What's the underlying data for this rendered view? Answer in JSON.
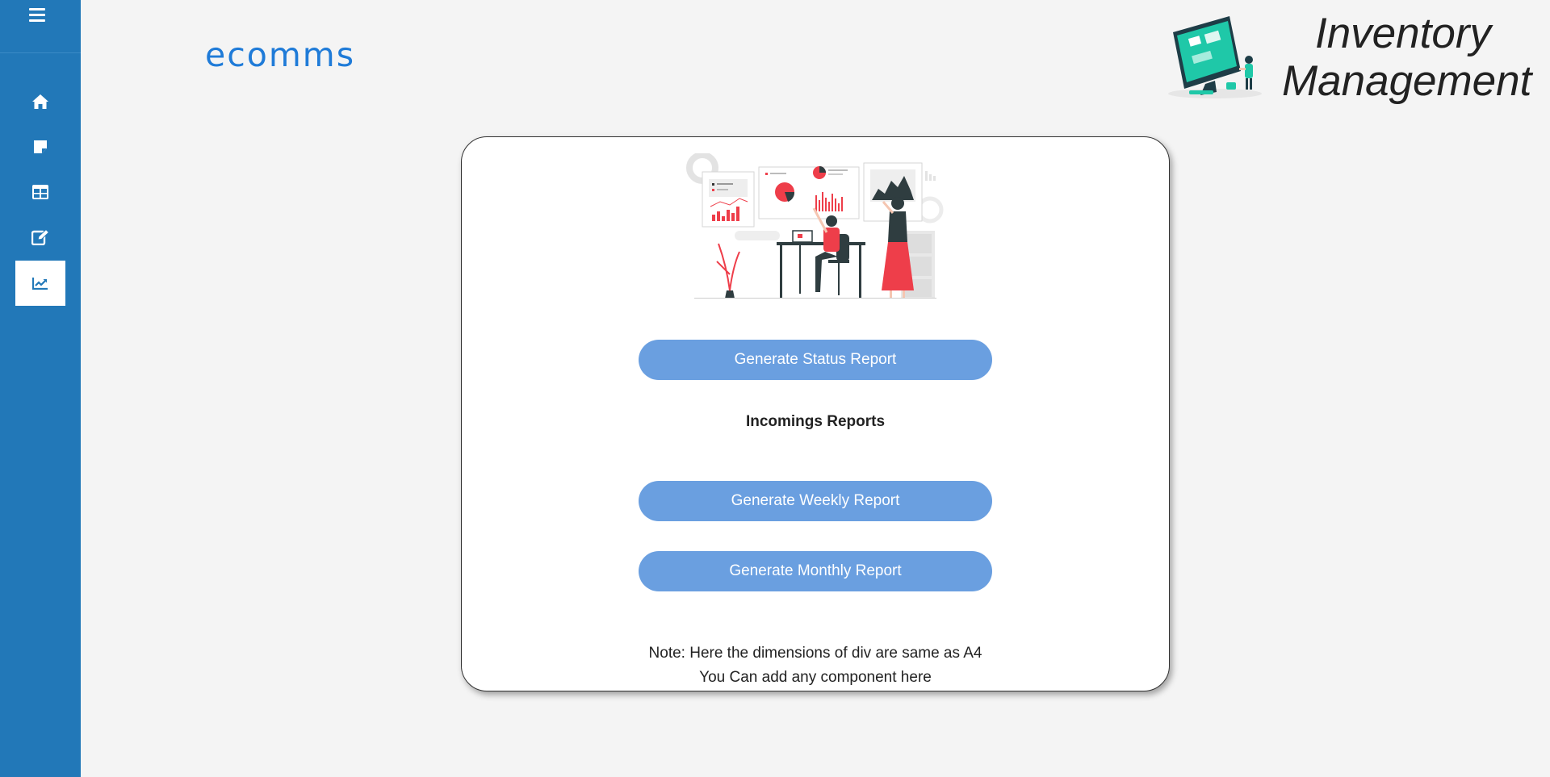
{
  "brand": "ecomms",
  "header": {
    "title_line1": "Inventory",
    "title_line2": "Management"
  },
  "sidebar": {
    "items": [
      {
        "name": "home",
        "icon": "home-icon"
      },
      {
        "name": "notes",
        "icon": "sticky-note-icon"
      },
      {
        "name": "table",
        "icon": "table-icon"
      },
      {
        "name": "edit",
        "icon": "edit-icon"
      },
      {
        "name": "reports",
        "icon": "chart-line-icon",
        "active": true
      }
    ]
  },
  "card": {
    "status_button": "Generate Status Report",
    "incomings_heading": "Incomings Reports",
    "weekly_button": "Generate Weekly Report",
    "monthly_button": "Generate Monthly Report",
    "note_line1": "Note: Here the dimensions of div are same as A4",
    "note_line2": "You Can add any component here"
  },
  "colors": {
    "sidebar": "#2278b8",
    "brand": "#1f7bd8",
    "button": "#6a9fe0",
    "accent_red": "#ee3e4a",
    "teal": "#1fc8a8"
  }
}
